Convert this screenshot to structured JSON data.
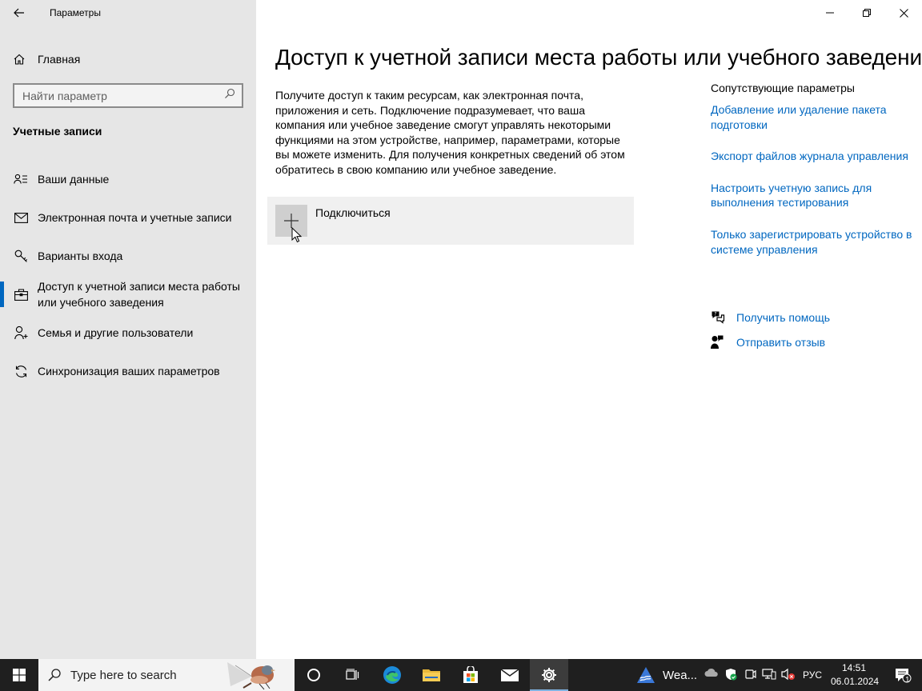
{
  "window": {
    "title": "Параметры"
  },
  "sidebar": {
    "home_label": "Главная",
    "search_placeholder": "Найти параметр",
    "section_title": "Учетные записи",
    "items": [
      {
        "label": "Ваши данные",
        "icon": "user-card-icon"
      },
      {
        "label": "Электронная почта и учетные записи",
        "icon": "mail-icon"
      },
      {
        "label": "Варианты входа",
        "icon": "key-icon"
      },
      {
        "label": "Доступ к учетной записи места работы или учебного заведения",
        "icon": "briefcase-icon",
        "selected": true
      },
      {
        "label": "Семья и другие пользователи",
        "icon": "people-icon"
      },
      {
        "label": "Синхронизация ваших параметров",
        "icon": "sync-icon"
      }
    ]
  },
  "main": {
    "title": "Доступ к учетной записи места работы или учебного заведения",
    "description": "Получите доступ к таким ресурсам, как электронная почта, приложения и сеть. Подключение подразумевает, что ваша компания или учебное заведение смогут управлять некоторыми функциями на этом устройстве, например, параметрами, которые вы можете изменить. Для получения конкретных сведений об этом обратитесь в свою компанию или учебное заведение.",
    "connect_label": "Подключиться"
  },
  "related": {
    "title": "Сопутствующие параметры",
    "links": [
      "Добавление или удаление пакета подготовки",
      "Экспорт файлов журнала управления",
      "Настроить учетную запись для выполнения тестирования",
      "Только зарегистрировать устройство в системе управления"
    ],
    "help": "Получить помощь",
    "feedback": "Отправить отзыв"
  },
  "taskbar": {
    "search_placeholder": "Type here to search",
    "weather": "Wea...",
    "lang": "РУС",
    "time": "14:51",
    "date": "06.01.2024",
    "notifications": "1"
  },
  "colors": {
    "accent": "#0067c0",
    "sidebar_bg": "#e6e6e6",
    "taskbar_bg": "#1f1f1f"
  }
}
